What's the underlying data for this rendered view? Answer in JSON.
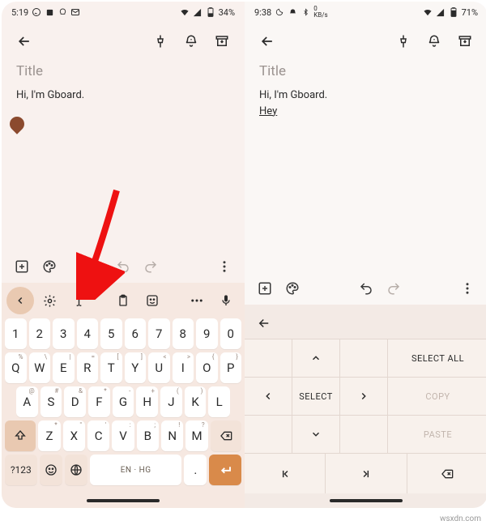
{
  "left": {
    "status": {
      "time": "5:19",
      "battery": "34%"
    },
    "title_placeholder": "Title",
    "body": "Hi, I'm Gboard.",
    "note_toolbar": {},
    "kb_toolbar": {},
    "keys": {
      "row1": [
        {
          "m": "1"
        },
        {
          "m": "2"
        },
        {
          "m": "3"
        },
        {
          "m": "4"
        },
        {
          "m": "5"
        },
        {
          "m": "6"
        },
        {
          "m": "7"
        },
        {
          "m": "8"
        },
        {
          "m": "9"
        },
        {
          "m": "0"
        }
      ],
      "row2": [
        {
          "m": "Q",
          "s": "%"
        },
        {
          "m": "W",
          "s": "\\"
        },
        {
          "m": "E",
          "s": "|"
        },
        {
          "m": "R",
          "s": "="
        },
        {
          "m": "T",
          "s": "["
        },
        {
          "m": "Y",
          "s": "]"
        },
        {
          "m": "U",
          "s": "<"
        },
        {
          "m": "I",
          "s": ">"
        },
        {
          "m": "O",
          "s": "{"
        },
        {
          "m": "P",
          "s": "}"
        }
      ],
      "row3": [
        {
          "m": "A",
          "s": "@"
        },
        {
          "m": "S",
          "s": "#"
        },
        {
          "m": "D",
          "s": "&"
        },
        {
          "m": "F",
          "s": "*"
        },
        {
          "m": "G",
          "s": "-"
        },
        {
          "m": "H",
          "s": "+"
        },
        {
          "m": "J",
          "s": "("
        },
        {
          "m": "K",
          "s": ")"
        },
        {
          "m": "L",
          "s": ""
        }
      ],
      "row4": [
        {
          "m": "Z",
          "s": "*"
        },
        {
          "m": "X",
          "s": "\""
        },
        {
          "m": "C",
          "s": "'"
        },
        {
          "m": "V",
          "s": ":"
        },
        {
          "m": "B",
          "s": ";"
        },
        {
          "m": "N",
          "s": "!"
        },
        {
          "m": "M",
          "s": "?"
        }
      ],
      "sym": "?123",
      "space": "EN · HG",
      "comma": ",",
      "dot": "."
    }
  },
  "right": {
    "status": {
      "time": "9:38",
      "kbps": "0",
      "kbps_unit": "KB/s",
      "battery": "71%"
    },
    "title_placeholder": "Title",
    "body": "Hi, I'm Gboard.",
    "body2": "Hey",
    "ccp": {
      "select": "SELECT",
      "select_all": "SELECT ALL",
      "copy": "COPY",
      "paste": "PASTE"
    }
  },
  "watermark": "wsxdn.com"
}
